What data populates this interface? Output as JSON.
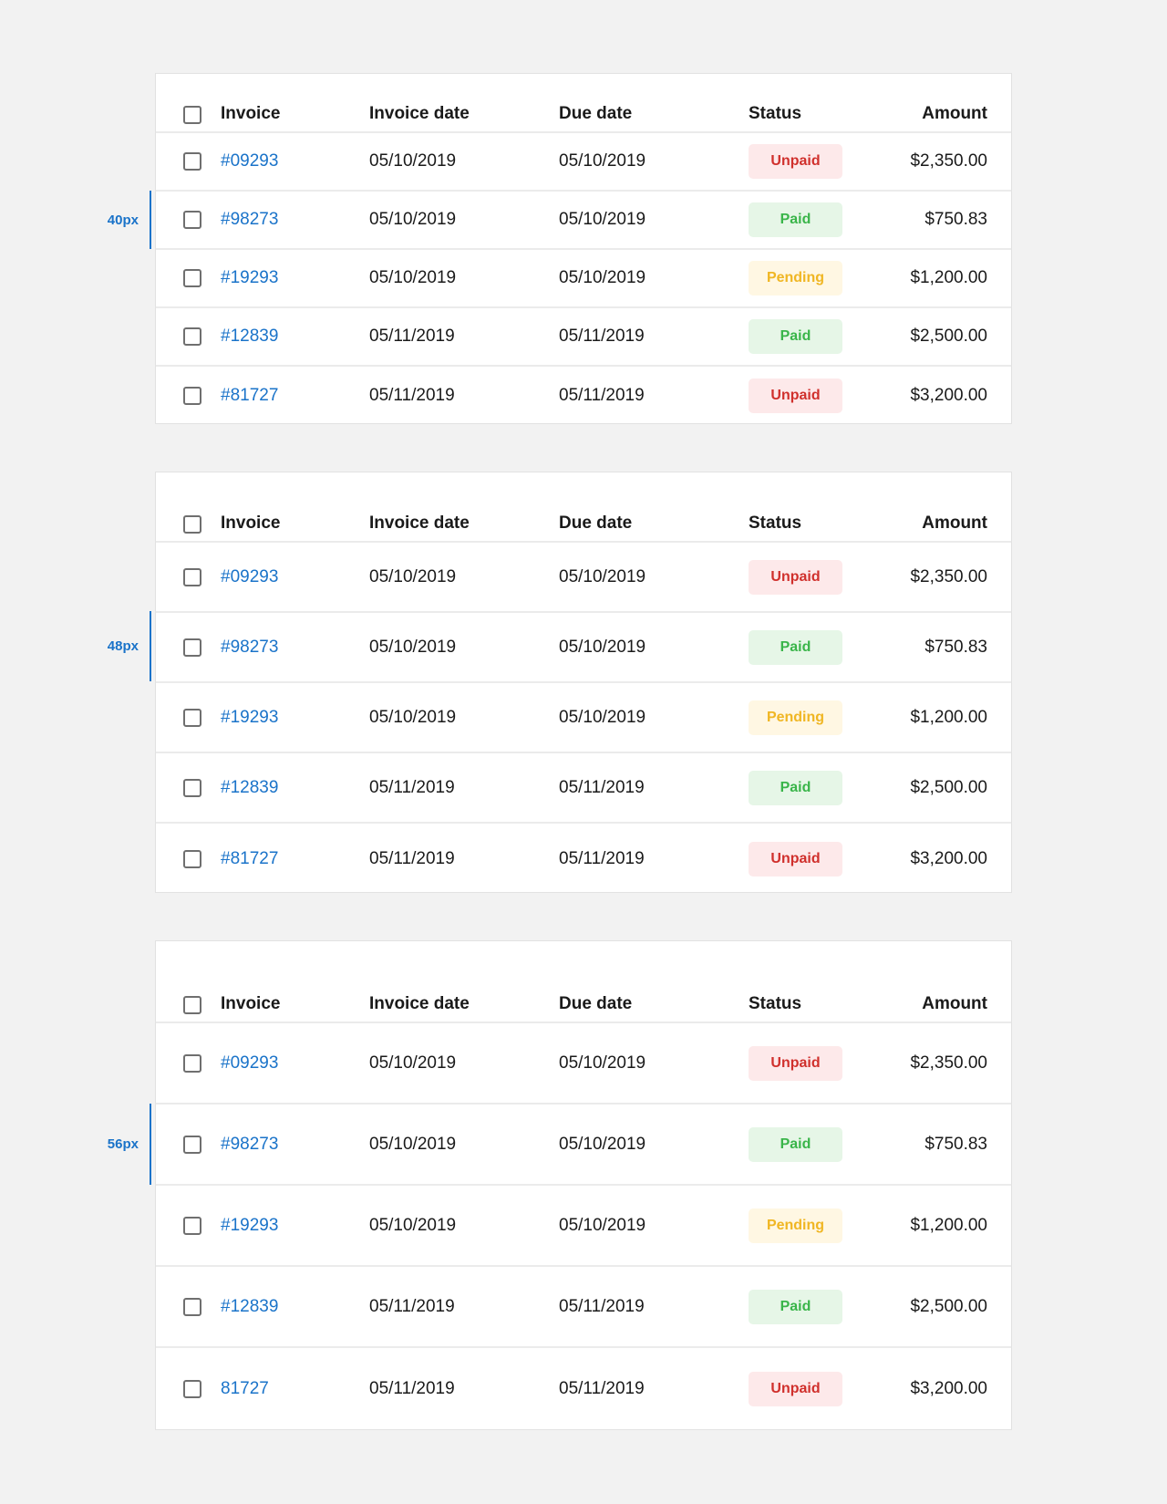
{
  "headers": {
    "invoice": "Invoice",
    "invoice_date": "Invoice date",
    "due_date": "Due date",
    "status": "Status",
    "amount": "Amount"
  },
  "colors": {
    "background": "#f2f2f2",
    "link": "#1a73c9",
    "unpaid_text": "#d0302c",
    "unpaid_bg": "#fde9ea",
    "paid_text": "#3ab54a",
    "paid_bg": "#e6f6e7",
    "pending_text": "#f0b623",
    "pending_bg": "#fff7e3"
  },
  "tables": [
    {
      "annotation": "40px",
      "rows": [
        {
          "invoice": "#09293",
          "invoice_date": "05/10/2019",
          "due_date": "05/10/2019",
          "status": "Unpaid",
          "status_kind": "unpaid",
          "amount": "$2,350.00"
        },
        {
          "invoice": "#98273",
          "invoice_date": "05/10/2019",
          "due_date": "05/10/2019",
          "status": "Paid",
          "status_kind": "paid",
          "amount": "$750.83"
        },
        {
          "invoice": "#19293",
          "invoice_date": "05/10/2019",
          "due_date": "05/10/2019",
          "status": "Pending",
          "status_kind": "pending",
          "amount": "$1,200.00"
        },
        {
          "invoice": "#12839",
          "invoice_date": "05/11/2019",
          "due_date": "05/11/2019",
          "status": "Paid",
          "status_kind": "paid",
          "amount": "$2,500.00"
        },
        {
          "invoice": "#81727",
          "invoice_date": "05/11/2019",
          "due_date": "05/11/2019",
          "status": "Unpaid",
          "status_kind": "unpaid",
          "amount": "$3,200.00"
        }
      ]
    },
    {
      "annotation": "48px",
      "rows": [
        {
          "invoice": "#09293",
          "invoice_date": "05/10/2019",
          "due_date": "05/10/2019",
          "status": "Unpaid",
          "status_kind": "unpaid",
          "amount": "$2,350.00"
        },
        {
          "invoice": "#98273",
          "invoice_date": "05/10/2019",
          "due_date": "05/10/2019",
          "status": "Paid",
          "status_kind": "paid",
          "amount": "$750.83"
        },
        {
          "invoice": "#19293",
          "invoice_date": "05/10/2019",
          "due_date": "05/10/2019",
          "status": "Pending",
          "status_kind": "pending",
          "amount": "$1,200.00"
        },
        {
          "invoice": "#12839",
          "invoice_date": "05/11/2019",
          "due_date": "05/11/2019",
          "status": "Paid",
          "status_kind": "paid",
          "amount": "$2,500.00"
        },
        {
          "invoice": "#81727",
          "invoice_date": "05/11/2019",
          "due_date": "05/11/2019",
          "status": "Unpaid",
          "status_kind": "unpaid",
          "amount": "$3,200.00"
        }
      ]
    },
    {
      "annotation": "56px",
      "rows": [
        {
          "invoice": "#09293",
          "invoice_date": "05/10/2019",
          "due_date": "05/10/2019",
          "status": "Unpaid",
          "status_kind": "unpaid",
          "amount": "$2,350.00"
        },
        {
          "invoice": "#98273",
          "invoice_date": "05/10/2019",
          "due_date": "05/10/2019",
          "status": "Paid",
          "status_kind": "paid",
          "amount": "$750.83"
        },
        {
          "invoice": "#19293",
          "invoice_date": "05/10/2019",
          "due_date": "05/10/2019",
          "status": "Pending",
          "status_kind": "pending",
          "amount": "$1,200.00"
        },
        {
          "invoice": "#12839",
          "invoice_date": "05/11/2019",
          "due_date": "05/11/2019",
          "status": "Paid",
          "status_kind": "paid",
          "amount": "$2,500.00"
        },
        {
          "invoice": "81727",
          "invoice_date": "05/11/2019",
          "due_date": "05/11/2019",
          "status": "Unpaid",
          "status_kind": "unpaid",
          "amount": "$3,200.00"
        }
      ]
    }
  ]
}
